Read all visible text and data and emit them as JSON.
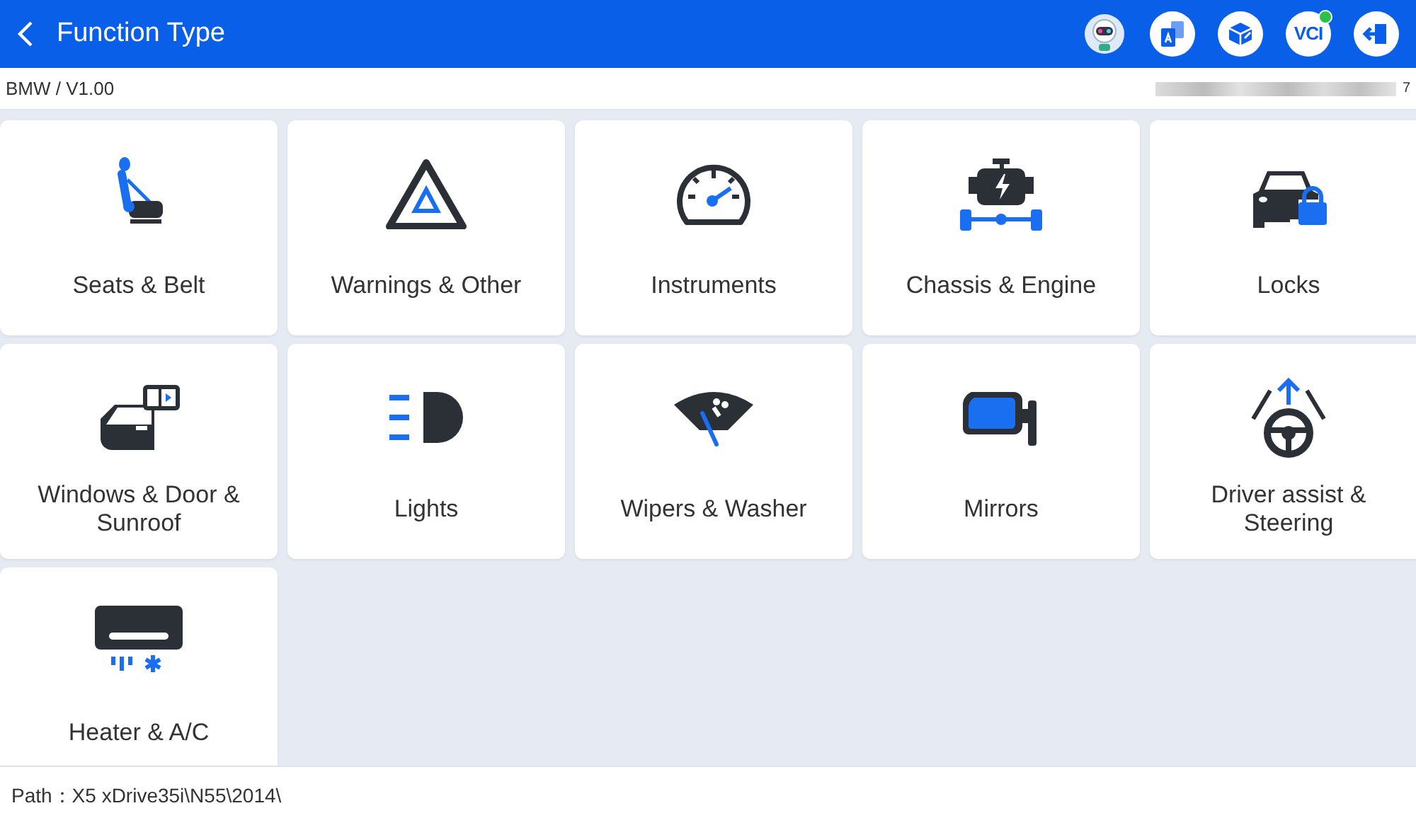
{
  "header": {
    "title": "Function Type",
    "actions": [
      {
        "kind": "avatar"
      },
      {
        "kind": "translate"
      },
      {
        "kind": "package"
      },
      {
        "kind": "vci",
        "label": "VCI",
        "connected": true
      },
      {
        "kind": "exit"
      }
    ]
  },
  "subheader": {
    "breadcrumb": "BMW / V1.00",
    "serial_tail": "7"
  },
  "functions": [
    {
      "label": "Seats & Belt"
    },
    {
      "label": "Warnings & Other"
    },
    {
      "label": "Instruments"
    },
    {
      "label": "Chassis & Engine"
    },
    {
      "label": "Locks"
    },
    {
      "label": "Windows & Door & Sunroof"
    },
    {
      "label": "Lights"
    },
    {
      "label": "Wipers & Washer"
    },
    {
      "label": "Mirrors"
    },
    {
      "label": "Driver assist & Steering"
    },
    {
      "label": "Heater & A/C"
    }
  ],
  "footer": {
    "path": "Path：X5 xDrive35i\\N55\\2014\\"
  }
}
